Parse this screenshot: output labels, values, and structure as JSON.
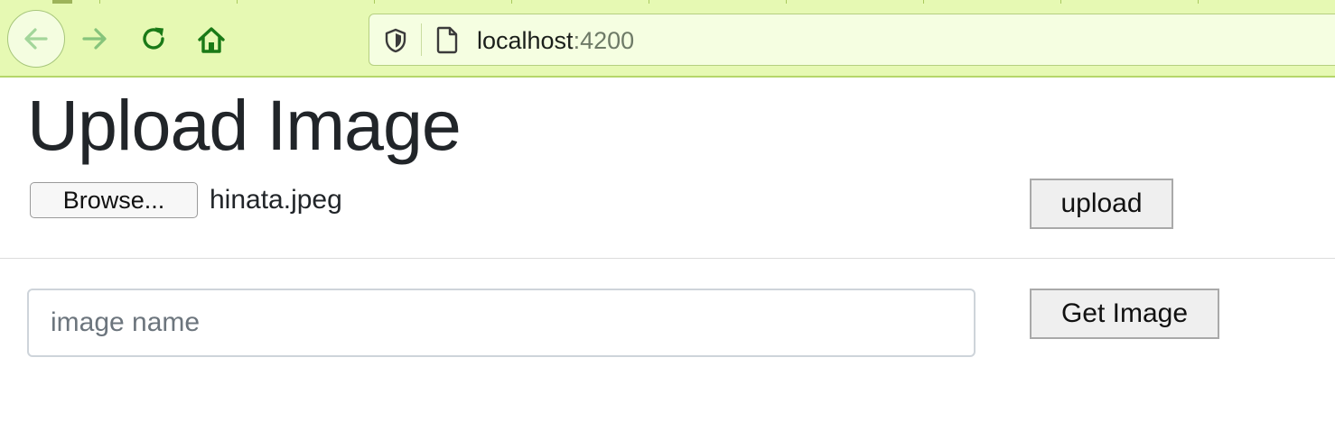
{
  "browser": {
    "url_host": "localhost",
    "url_port": ":4200",
    "icons": [
      "back-arrow-icon",
      "forward-arrow-icon",
      "reload-icon",
      "home-icon",
      "shield-icon",
      "page-icon"
    ],
    "colors": {
      "toolbar": "#e6f9b3",
      "icon_green": "#1a7a17"
    }
  },
  "page": {
    "title": "Upload Image",
    "browse_label": "Browse...",
    "selected_file": "hinata.jpeg",
    "upload_label": "upload",
    "image_name_placeholder": "image name",
    "image_name_value": "",
    "get_image_label": "Get Image"
  }
}
